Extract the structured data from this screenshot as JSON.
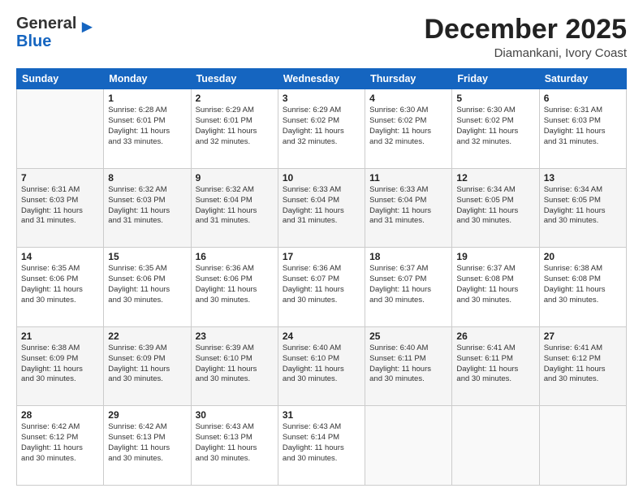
{
  "logo": {
    "line1": "General",
    "line2": "Blue",
    "arrow": "▶"
  },
  "title": "December 2025",
  "location": "Diamankani, Ivory Coast",
  "days_header": [
    "Sunday",
    "Monday",
    "Tuesday",
    "Wednesday",
    "Thursday",
    "Friday",
    "Saturday"
  ],
  "weeks": [
    [
      {
        "num": "",
        "info": ""
      },
      {
        "num": "1",
        "info": "Sunrise: 6:28 AM\nSunset: 6:01 PM\nDaylight: 11 hours\nand 33 minutes."
      },
      {
        "num": "2",
        "info": "Sunrise: 6:29 AM\nSunset: 6:01 PM\nDaylight: 11 hours\nand 32 minutes."
      },
      {
        "num": "3",
        "info": "Sunrise: 6:29 AM\nSunset: 6:02 PM\nDaylight: 11 hours\nand 32 minutes."
      },
      {
        "num": "4",
        "info": "Sunrise: 6:30 AM\nSunset: 6:02 PM\nDaylight: 11 hours\nand 32 minutes."
      },
      {
        "num": "5",
        "info": "Sunrise: 6:30 AM\nSunset: 6:02 PM\nDaylight: 11 hours\nand 32 minutes."
      },
      {
        "num": "6",
        "info": "Sunrise: 6:31 AM\nSunset: 6:03 PM\nDaylight: 11 hours\nand 31 minutes."
      }
    ],
    [
      {
        "num": "7",
        "info": "Sunrise: 6:31 AM\nSunset: 6:03 PM\nDaylight: 11 hours\nand 31 minutes."
      },
      {
        "num": "8",
        "info": "Sunrise: 6:32 AM\nSunset: 6:03 PM\nDaylight: 11 hours\nand 31 minutes."
      },
      {
        "num": "9",
        "info": "Sunrise: 6:32 AM\nSunset: 6:04 PM\nDaylight: 11 hours\nand 31 minutes."
      },
      {
        "num": "10",
        "info": "Sunrise: 6:33 AM\nSunset: 6:04 PM\nDaylight: 11 hours\nand 31 minutes."
      },
      {
        "num": "11",
        "info": "Sunrise: 6:33 AM\nSunset: 6:04 PM\nDaylight: 11 hours\nand 31 minutes."
      },
      {
        "num": "12",
        "info": "Sunrise: 6:34 AM\nSunset: 6:05 PM\nDaylight: 11 hours\nand 30 minutes."
      },
      {
        "num": "13",
        "info": "Sunrise: 6:34 AM\nSunset: 6:05 PM\nDaylight: 11 hours\nand 30 minutes."
      }
    ],
    [
      {
        "num": "14",
        "info": "Sunrise: 6:35 AM\nSunset: 6:06 PM\nDaylight: 11 hours\nand 30 minutes."
      },
      {
        "num": "15",
        "info": "Sunrise: 6:35 AM\nSunset: 6:06 PM\nDaylight: 11 hours\nand 30 minutes."
      },
      {
        "num": "16",
        "info": "Sunrise: 6:36 AM\nSunset: 6:06 PM\nDaylight: 11 hours\nand 30 minutes."
      },
      {
        "num": "17",
        "info": "Sunrise: 6:36 AM\nSunset: 6:07 PM\nDaylight: 11 hours\nand 30 minutes."
      },
      {
        "num": "18",
        "info": "Sunrise: 6:37 AM\nSunset: 6:07 PM\nDaylight: 11 hours\nand 30 minutes."
      },
      {
        "num": "19",
        "info": "Sunrise: 6:37 AM\nSunset: 6:08 PM\nDaylight: 11 hours\nand 30 minutes."
      },
      {
        "num": "20",
        "info": "Sunrise: 6:38 AM\nSunset: 6:08 PM\nDaylight: 11 hours\nand 30 minutes."
      }
    ],
    [
      {
        "num": "21",
        "info": "Sunrise: 6:38 AM\nSunset: 6:09 PM\nDaylight: 11 hours\nand 30 minutes."
      },
      {
        "num": "22",
        "info": "Sunrise: 6:39 AM\nSunset: 6:09 PM\nDaylight: 11 hours\nand 30 minutes."
      },
      {
        "num": "23",
        "info": "Sunrise: 6:39 AM\nSunset: 6:10 PM\nDaylight: 11 hours\nand 30 minutes."
      },
      {
        "num": "24",
        "info": "Sunrise: 6:40 AM\nSunset: 6:10 PM\nDaylight: 11 hours\nand 30 minutes."
      },
      {
        "num": "25",
        "info": "Sunrise: 6:40 AM\nSunset: 6:11 PM\nDaylight: 11 hours\nand 30 minutes."
      },
      {
        "num": "26",
        "info": "Sunrise: 6:41 AM\nSunset: 6:11 PM\nDaylight: 11 hours\nand 30 minutes."
      },
      {
        "num": "27",
        "info": "Sunrise: 6:41 AM\nSunset: 6:12 PM\nDaylight: 11 hours\nand 30 minutes."
      }
    ],
    [
      {
        "num": "28",
        "info": "Sunrise: 6:42 AM\nSunset: 6:12 PM\nDaylight: 11 hours\nand 30 minutes."
      },
      {
        "num": "29",
        "info": "Sunrise: 6:42 AM\nSunset: 6:13 PM\nDaylight: 11 hours\nand 30 minutes."
      },
      {
        "num": "30",
        "info": "Sunrise: 6:43 AM\nSunset: 6:13 PM\nDaylight: 11 hours\nand 30 minutes."
      },
      {
        "num": "31",
        "info": "Sunrise: 6:43 AM\nSunset: 6:14 PM\nDaylight: 11 hours\nand 30 minutes."
      },
      {
        "num": "",
        "info": ""
      },
      {
        "num": "",
        "info": ""
      },
      {
        "num": "",
        "info": ""
      }
    ]
  ]
}
